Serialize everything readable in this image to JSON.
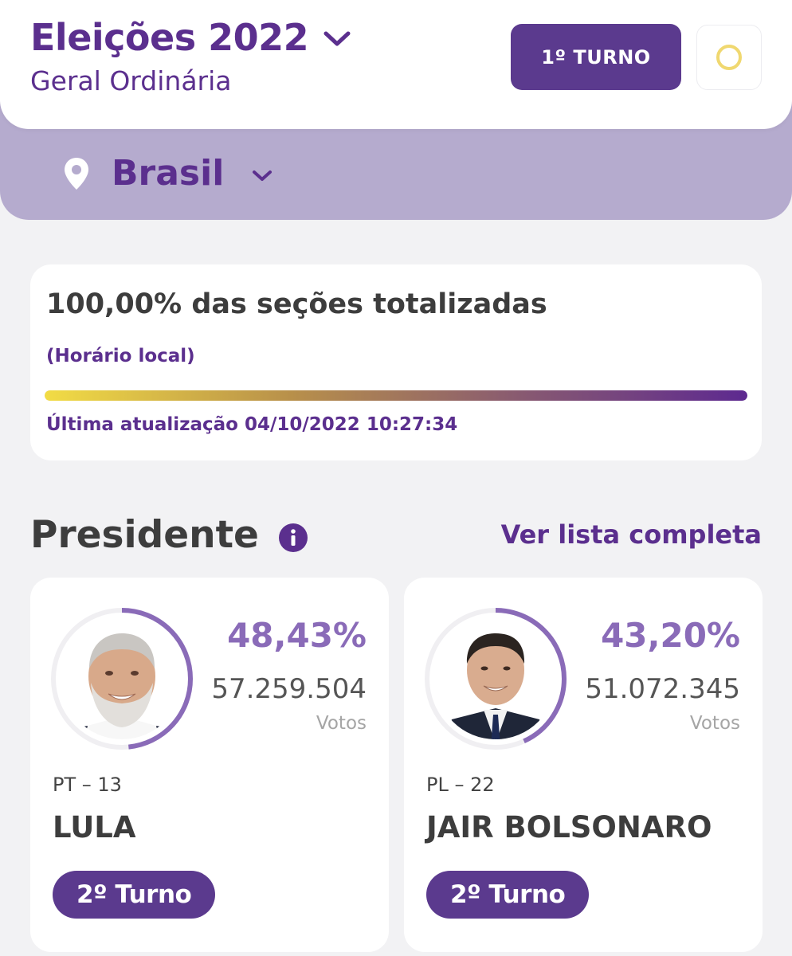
{
  "header": {
    "title": "Eleições 2022",
    "subtitle": "Geral Ordinária",
    "turno_button": "1º TURNO",
    "theme_toggle_icon": "circle-outline-icon"
  },
  "location": {
    "label": "Brasil"
  },
  "progress": {
    "title": "100,00% das seções totalizadas",
    "local_time_note": "(Horário local)",
    "value": 1.0,
    "last_update": "Última atualização 04/10/2022 10:27:34"
  },
  "section": {
    "title": "Presidente",
    "see_all": "Ver lista completa"
  },
  "candidates": [
    {
      "percent": "48,43%",
      "percent_value": 0.4843,
      "votes": "57.259.504",
      "votes_label": "Votos",
      "party": "PT – 13",
      "name": "LULA",
      "round_badge": "2º Turno"
    },
    {
      "percent": "43,20%",
      "percent_value": 0.432,
      "votes": "51.072.345",
      "votes_label": "Votos",
      "party": "PL – 22",
      "name": "JAIR BOLSONARO",
      "round_badge": "2º Turno"
    }
  ],
  "colors": {
    "brand_purple": "#5b2f8e",
    "band_lilac": "#b5abce",
    "ring_purple": "#8a6bb8",
    "accent_yellow": "#f0d870"
  }
}
